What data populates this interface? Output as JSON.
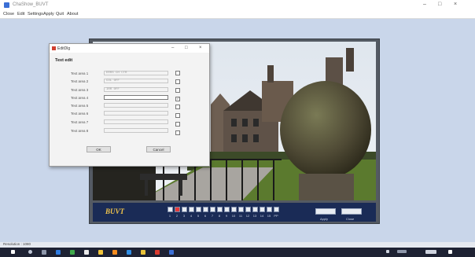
{
  "window": {
    "title": "ChaShow_BUVT",
    "min": "–",
    "max": "□",
    "close": "×"
  },
  "menu": [
    "Close",
    "Edit",
    "Settings",
    "Apply",
    "Quit",
    "About"
  ],
  "dialog": {
    "title": "EditDlg",
    "heading": "Text edit",
    "rows": [
      {
        "label": "Text area 1",
        "value": "ERRS  CH CTR",
        "checked": false,
        "active": false
      },
      {
        "label": "Text area 2",
        "value": "COL  OFF",
        "checked": false,
        "active": false
      },
      {
        "label": "Text area 3",
        "value": "IRR  OFF",
        "checked": false,
        "active": false
      },
      {
        "label": "Text area 4",
        "value": "",
        "checked": true,
        "active": true
      },
      {
        "label": "Text area 5",
        "value": "",
        "checked": false,
        "active": false
      },
      {
        "label": "Text area 6",
        "value": "",
        "checked": false,
        "active": false
      },
      {
        "label": "Text area 7",
        "value": "",
        "checked": false,
        "active": false
      },
      {
        "label": "Text area 8",
        "value": "",
        "checked": false,
        "active": false
      }
    ],
    "ok": "OK",
    "cancel": "Cancel"
  },
  "control": {
    "brand": "BUVT",
    "channels": [
      "1",
      "2",
      "3",
      "4",
      "5",
      "6",
      "7",
      "8",
      "9",
      "10",
      "11",
      "12",
      "13",
      "14",
      "15",
      "PP"
    ],
    "selected_channel": "2",
    "apply": "Apply",
    "close": "Close"
  },
  "status": {
    "text": "Resolution : 1080"
  },
  "colors": {
    "panel": "#1a2b56",
    "brand": "#f4c64a",
    "selected": "#e53a3a"
  }
}
